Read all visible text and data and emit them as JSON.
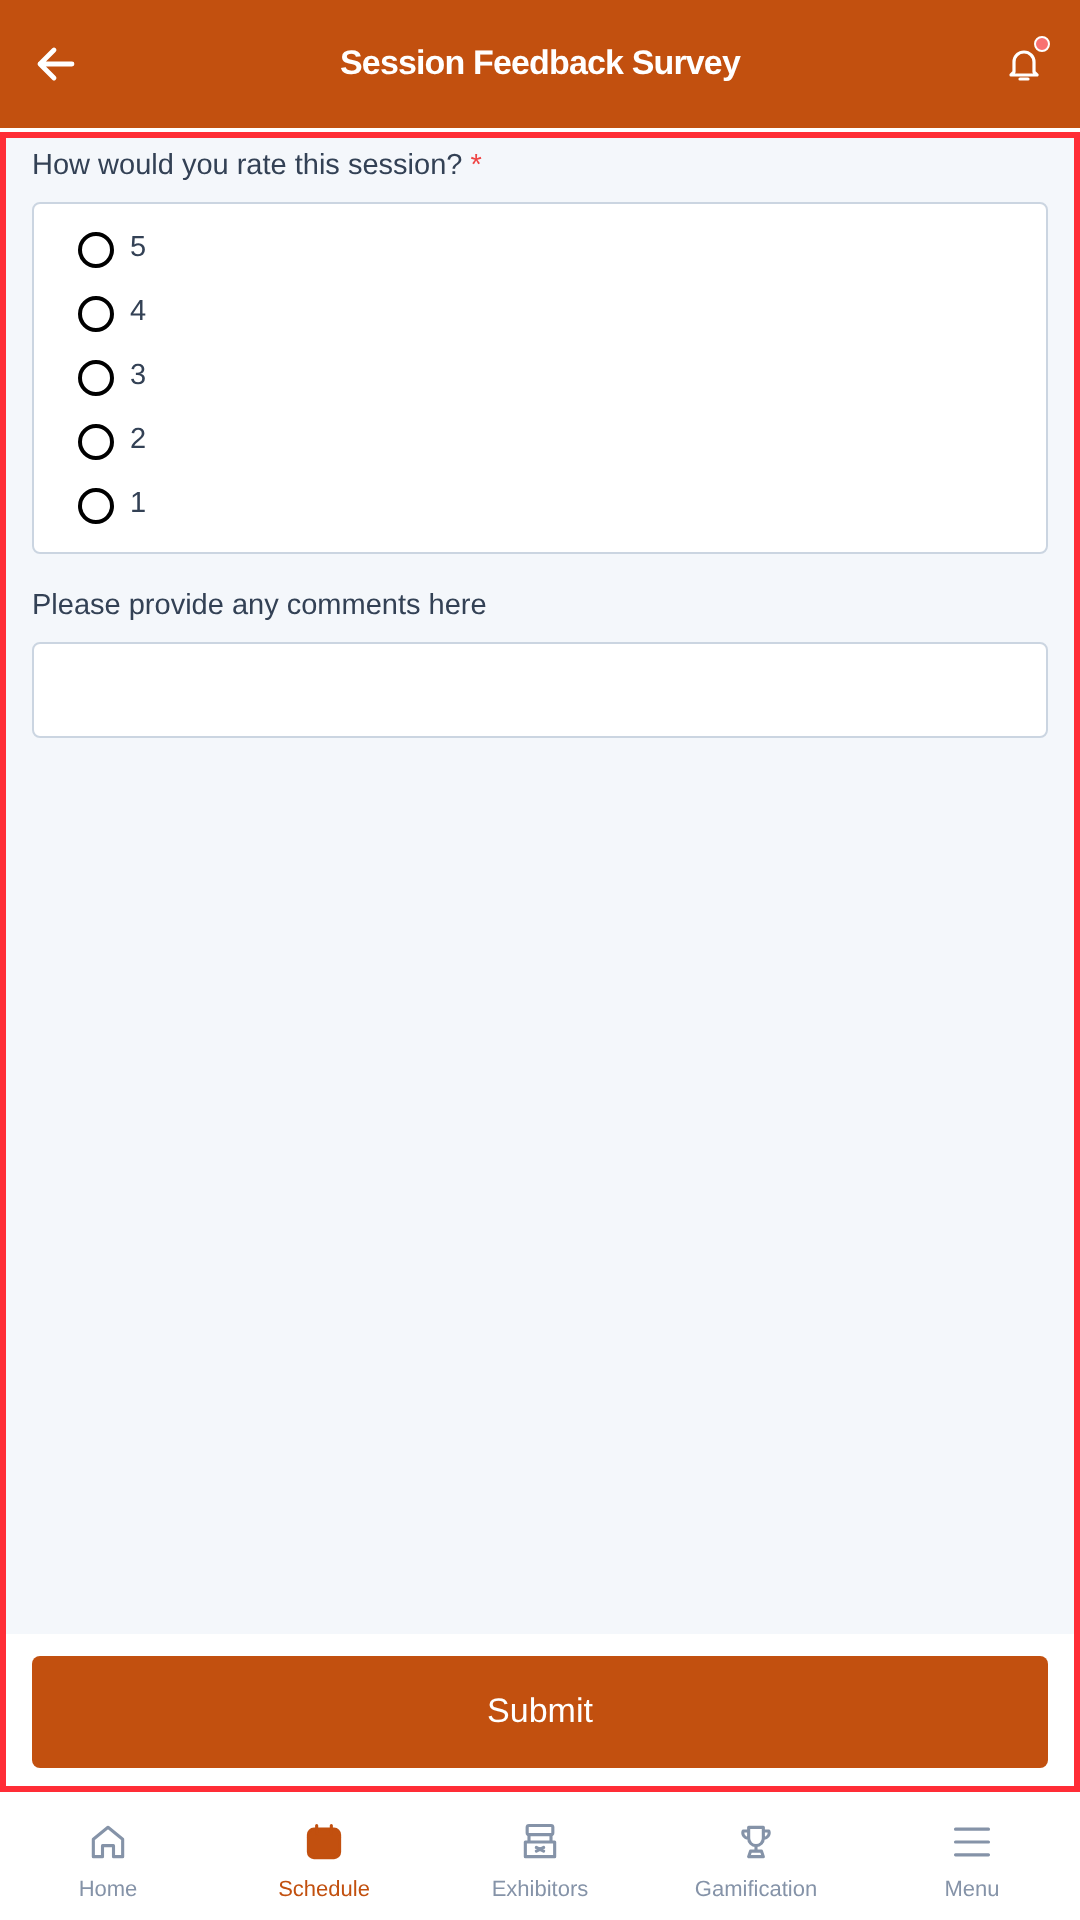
{
  "header": {
    "title": "Session Feedback Survey",
    "has_notification": true
  },
  "questions": [
    {
      "kind": "radio",
      "label": "How would you rate this session?",
      "required_mark": "*",
      "options": [
        {
          "label": "5",
          "selected": false
        },
        {
          "label": "4",
          "selected": false
        },
        {
          "label": "3",
          "selected": false
        },
        {
          "label": "2",
          "selected": false
        },
        {
          "label": "1",
          "selected": false
        }
      ]
    },
    {
      "kind": "text",
      "label": "Please provide any comments here"
    }
  ],
  "submit": "Submit",
  "nav": [
    {
      "label": "Home",
      "kind": "home",
      "selected": false
    },
    {
      "label": "Schedule",
      "kind": "calendar",
      "selected": true
    },
    {
      "label": "Exhibitors",
      "kind": "booth",
      "selected": false
    },
    {
      "label": "Gamification",
      "kind": "trophy",
      "selected": false
    },
    {
      "label": "Menu",
      "kind": "menu",
      "selected": false
    }
  ]
}
